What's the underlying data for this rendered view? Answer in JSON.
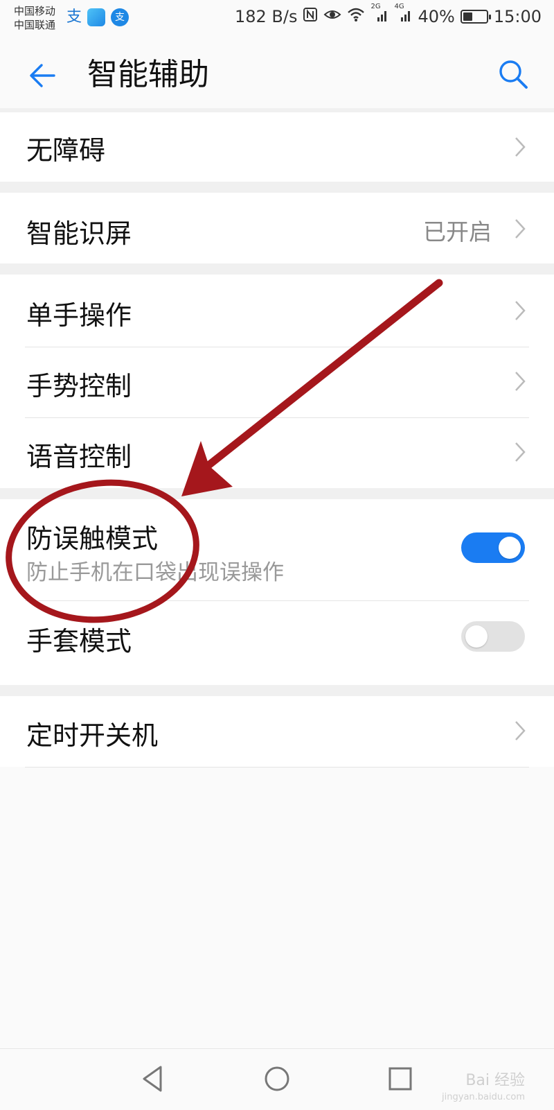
{
  "status_bar": {
    "carrier_1": "中国移动",
    "carrier_2": "中国联通",
    "net_speed": "182 B/s",
    "signal_1_label": "2G",
    "signal_2_label": "4G",
    "battery_percent": "40%",
    "battery_level": 0.4,
    "time": "15:00"
  },
  "header": {
    "title": "智能辅助"
  },
  "items": {
    "accessibility": {
      "label": "无障碍"
    },
    "smart_screen": {
      "label": "智能识屏",
      "value": "已开启"
    },
    "one_hand": {
      "label": "单手操作"
    },
    "gesture": {
      "label": "手势控制"
    },
    "voice": {
      "label": "语音控制"
    },
    "pocket_mode": {
      "label": "防误触模式",
      "subtitle": "防止手机在口袋出现误操作",
      "enabled": true
    },
    "glove_mode": {
      "label": "手套模式",
      "enabled": false
    },
    "scheduled_power": {
      "label": "定时开关机"
    }
  },
  "watermark": {
    "brand": "Bai 经验",
    "url": "jingyan.baidu.com"
  },
  "colors": {
    "accent": "#1a7cf2",
    "toggle_off": "#e2e2e2",
    "annotation": "#a5171c"
  }
}
